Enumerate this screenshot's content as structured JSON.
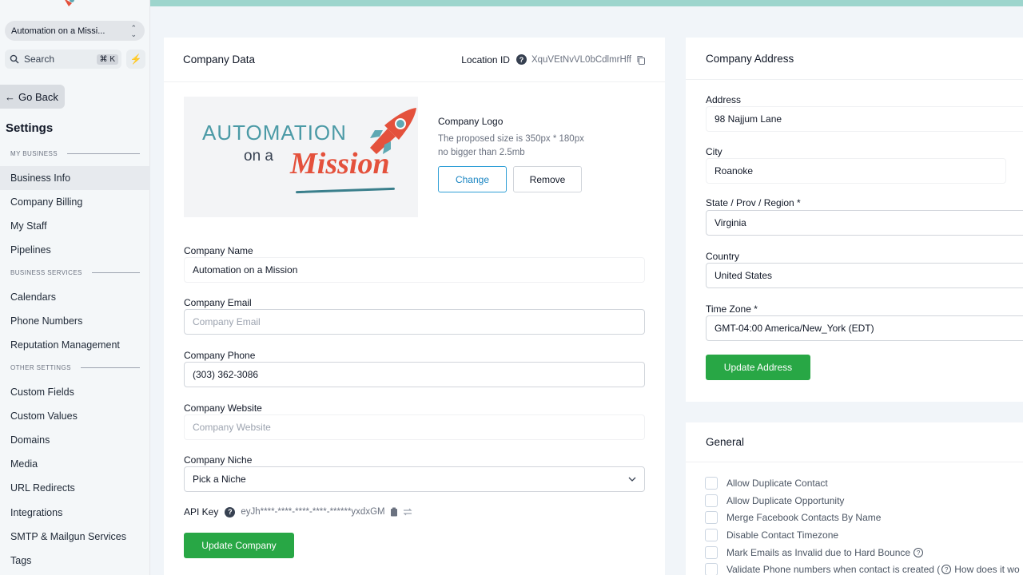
{
  "sidebar": {
    "location_name": "Automation on a Missi...",
    "search_label": "Search",
    "search_shortcut": "⌘ K",
    "back_label": "Go Back",
    "title": "Settings",
    "sections": {
      "my_business": "MY BUSINESS",
      "business_services": "BUSINESS SERVICES",
      "other_settings": "OTHER SETTINGS"
    },
    "items": {
      "business_info": "Business Info",
      "company_billing": "Company Billing",
      "my_staff": "My Staff",
      "pipelines": "Pipelines",
      "calendars": "Calendars",
      "phone_numbers": "Phone Numbers",
      "reputation_management": "Reputation Management",
      "custom_fields": "Custom Fields",
      "custom_values": "Custom Values",
      "domains": "Domains",
      "media": "Media",
      "url_redirects": "URL Redirects",
      "integrations": "Integrations",
      "smtp": "SMTP & Mailgun Services",
      "tags": "Tags"
    }
  },
  "company_data": {
    "title": "Company Data",
    "location_id_label": "Location ID",
    "location_id_value": "XquVEtNvVL0bCdlmrHff",
    "logo_text_top": "AUTOMATION",
    "logo_text_on_a": "on a",
    "logo_text_mission": "Mission",
    "logo_label": "Company Logo",
    "logo_hint_1": "The proposed size is 350px * 180px",
    "logo_hint_2": "no bigger than 2.5mb",
    "change_label": "Change",
    "remove_label": "Remove",
    "name_label": "Company Name",
    "name_value": "Automation on a Mission",
    "email_label": "Company Email",
    "email_placeholder": "Company Email",
    "phone_label": "Company Phone",
    "phone_value": "(303) 362-3086",
    "website_label": "Company Website",
    "website_placeholder": "Company Website",
    "niche_label": "Company Niche",
    "niche_value": "Pick a Niche",
    "api_key_label": "API Key",
    "api_key_value": "eyJh****-****-****-****-******yxdxGM",
    "update_label": "Update Company"
  },
  "company_address": {
    "title": "Company Address",
    "address_label": "Address",
    "address_value": "98 Najjum Lane",
    "city_label": "City",
    "city_value": "Roanoke",
    "state_label": "State / Prov / Region *",
    "state_value": "Virginia",
    "country_label": "Country",
    "country_value": "United States",
    "timezone_label": "Time Zone *",
    "timezone_value": "GMT-04:00 America/New_York (EDT)",
    "update_label": "Update Address"
  },
  "general": {
    "title": "General",
    "options": [
      "Allow Duplicate Contact",
      "Allow Duplicate Opportunity",
      "Merge Facebook Contacts By Name",
      "Disable Contact Timezone",
      "Mark Emails as Invalid due to Hard Bounce",
      "Validate Phone numbers when contact is created ("
    ],
    "how_label": "How does it wo"
  },
  "colors": {
    "accent_green": "#28a745",
    "top_bar": "#9dd5cd",
    "change_blue": "#2f9fd6"
  }
}
